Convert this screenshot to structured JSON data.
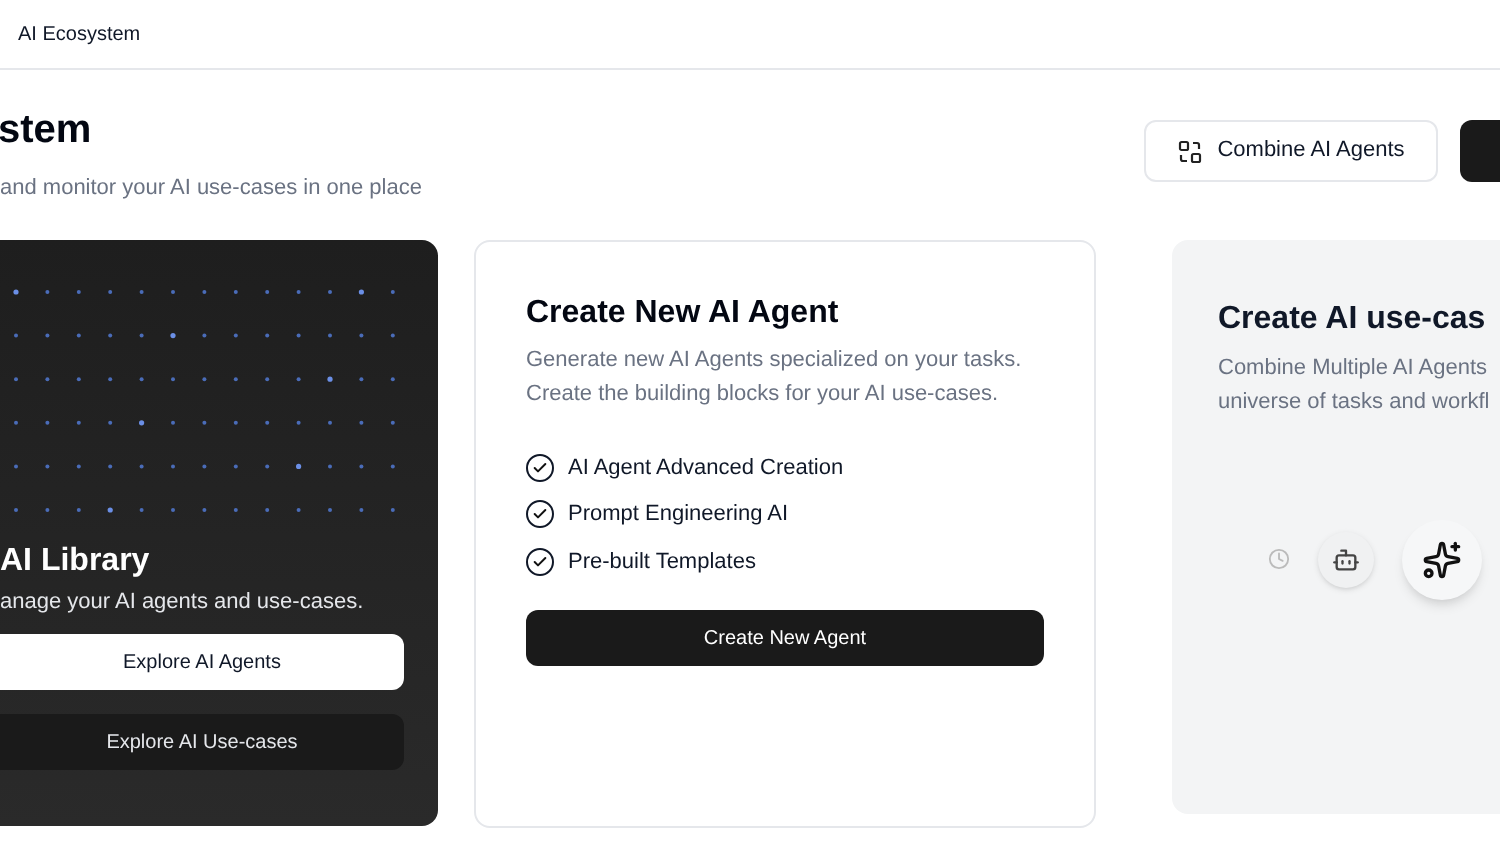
{
  "topbar": {
    "title": "AI Ecosystem"
  },
  "header": {
    "title": "stem",
    "subtitle": "and monitor your AI use-cases in one place",
    "buttons": [
      {
        "label": "Combine AI Agents",
        "kind": "outline"
      },
      {
        "kind": "dark"
      }
    ]
  },
  "library_card": {
    "title": "AI Library",
    "description": "anage your AI agents and use-cases.",
    "buttons": [
      {
        "label": "Explore AI Agents",
        "kind": "light"
      },
      {
        "label": "Explore AI Use-cases",
        "kind": "dark"
      }
    ]
  },
  "agent_card": {
    "title": "Create New AI Agent",
    "description": "Generate new AI Agents specialized on your tasks. Create the building blocks for your AI use-cases.",
    "features": [
      {
        "label": "AI Agent Advanced Creation",
        "checked": true
      },
      {
        "label": "Prompt Engineering AI",
        "checked": true
      },
      {
        "label": "Pre-built Templates",
        "checked": true
      }
    ],
    "button": "Create New Agent"
  },
  "usecase_card": {
    "title": "Create AI use-cas",
    "description_lines": [
      "Combine Multiple AI Agents",
      "universe of tasks and workfl"
    ]
  }
}
